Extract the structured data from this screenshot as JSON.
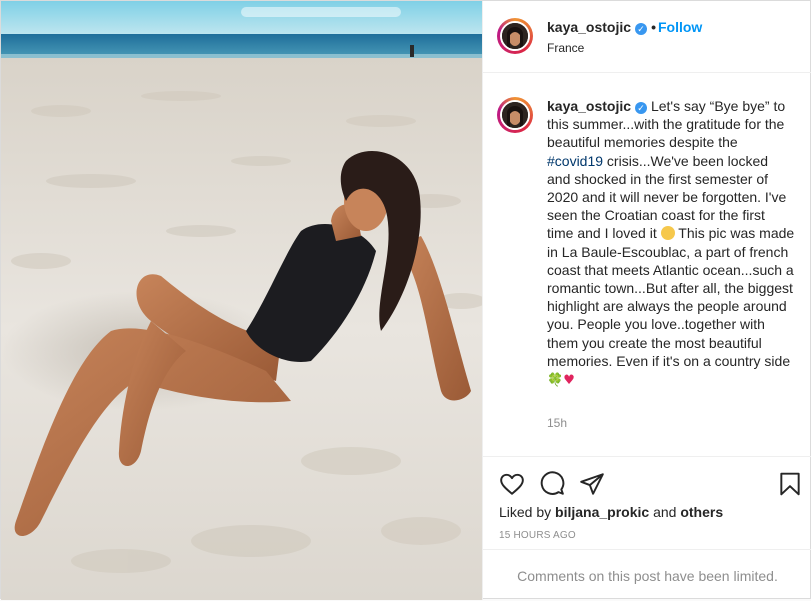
{
  "post": {
    "author": {
      "username": "kaya_ostojic",
      "verified": true,
      "follow_label": "Follow",
      "separator": "•",
      "location": "France"
    },
    "caption": {
      "username": "kaya_ostojic",
      "text_part1": " Let's say “Bye bye” to this summer...with the gratitude for the beautiful memories despite the ",
      "hashtag": "#covid19",
      "text_part2": " crisis...We've been locked and shocked in the first semester of 2020 and it will never be forgotten. I've seen the Croatian coast for the first time and I loved it ",
      "text_part3": " This pic was made in La Baule-Escoublac, a part of french coast that meets Atlantic ocean...such a romantic town...But after all, the biggest highlight are always the people around you. People you love..together with them you create the most beautiful memories. Even if it's on a country side ",
      "emoji_clover": "🍀",
      "emoji_heart": "♥",
      "time_ago": "15h"
    },
    "actions": {
      "like_icon": "heart-outline-icon",
      "comment_icon": "comment-bubble-icon",
      "share_icon": "paper-plane-icon",
      "save_icon": "bookmark-icon"
    },
    "likes": {
      "prefix": "Liked by ",
      "user": "biljana_prokic",
      "connector": " and ",
      "others": "others"
    },
    "posted_time": "15 HOURS AGO",
    "comments_notice": "Comments on this post have been limited."
  },
  "colors": {
    "link_blue": "#0095f6",
    "verified_blue": "#3897f0",
    "hashtag": "#00376b",
    "muted": "#8e8e8e",
    "text": "#262626"
  }
}
